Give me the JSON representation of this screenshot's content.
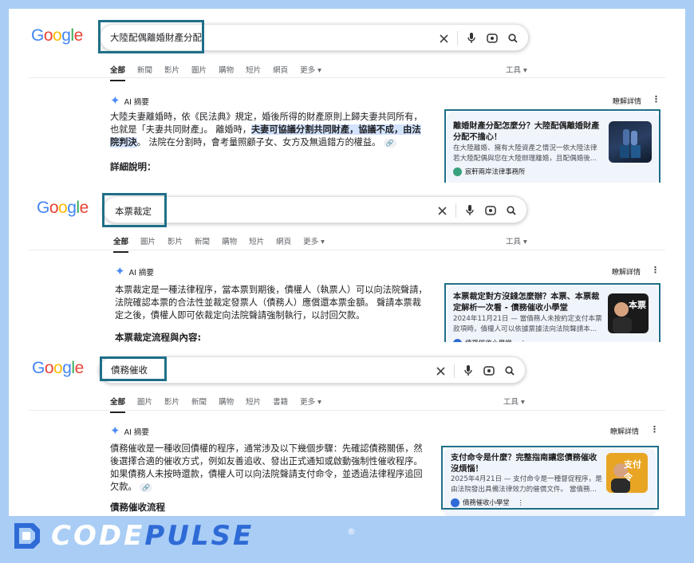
{
  "sections": [
    {
      "query": "大陸配偶離婚財產分配",
      "tabs": [
        "全部",
        "新聞",
        "影片",
        "圖片",
        "購物",
        "短片",
        "網頁",
        "更多 ▾"
      ],
      "tools": "工具 ▾",
      "ai_label": "AI 摘要",
      "learn_more": "瞭解詳情",
      "text_a": "大陸夫妻離婚時，依《民法典》規定，婚後所得的財產原則上歸夫妻共同所有，也就是「夫妻共同財產」。 離婚時，",
      "text_hl": "夫妻可協議分割共同財產，協議不成，由法院判決",
      "text_b": "。 法院在分割時，會考量照顧子女、女方及無過錯方的權益。",
      "sub_heading": "詳細說明：",
      "card_title": "離婚財產分配怎麼分？大陸配偶離婚財產分配不擔心！",
      "card_snippet": "在大陸離婚、擁有大陸資產之情況一依大陸法律若大陸配偶與您在大陸辦理離婚，且配偶婚後...",
      "card_source": "宸軒兩岸法律事務所"
    },
    {
      "query": "本票裁定",
      "tabs": [
        "全部",
        "圖片",
        "影片",
        "新聞",
        "購物",
        "短片",
        "網頁",
        "更多 ▾"
      ],
      "tools": "工具 ▾",
      "ai_label": "AI 摘要",
      "learn_more": "瞭解詳情",
      "text": "本票裁定是一種法律程序，當本票到期後，債權人（執票人）可以向法院聲請，法院確認本票的合法性並裁定發票人（債務人）應償還本票金額。 聲請本票裁定之後，債權人即可依裁定向法院聲請強制執行，以討回欠款。",
      "sub_heading": "本票裁定流程與內容:",
      "card_title": "本票裁定對方沒錢怎麼辦？本票、本票裁定解析一次看 - 債務催收小學堂",
      "card_snippet": "2024年11月21日 — 當債務人未按約定支付本票款項時，債權人可以依據票據法向法院聲請本...",
      "card_source": "債務催收小學堂",
      "thumb_text": "本票"
    },
    {
      "query": "債務催收",
      "tabs": [
        "全部",
        "圖片",
        "影片",
        "新聞",
        "購物",
        "短片",
        "書籍",
        "更多 ▾"
      ],
      "tools": "工具 ▾",
      "ai_label": "AI 摘要",
      "learn_more": "瞭解詳情",
      "text": "債務催收是一種收回債權的程序，通常涉及以下幾個步驟：先確認債務關係，然後選擇合適的催收方式，例如友善追收、發出正式通知或啟動強制性催收程序。如果債務人未按時還款，債權人可以向法院聲請支付命令，並透過法律程序追回欠款。",
      "sub_heading": "債務催收流程",
      "card_title": "支付命令是什麼？完整指南讓您債務催收沒煩惱！",
      "card_snippet": "2025年4月21日 — 支付命令是一種督促程序，是由法院發出具備法律效力的催償文件。 當債務...",
      "card_source": "債務催收小學堂",
      "thumb_text": "支付令"
    }
  ],
  "brand": {
    "text_a": "CODE",
    "text_b": "PULSE",
    "text_c": "",
    "reg": "®"
  },
  "colors": {
    "accent": "#1f6f88",
    "background": "#a9cdf5",
    "ai_star": "#4c8df6"
  }
}
